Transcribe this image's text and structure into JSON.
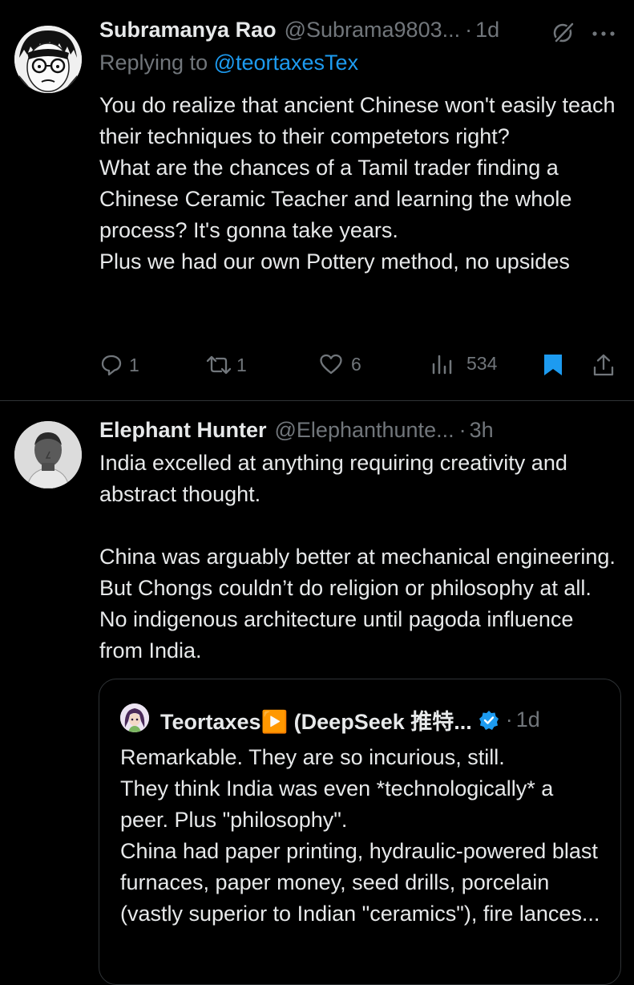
{
  "tweets": [
    {
      "author_name": "Subramanya Rao",
      "handle": "@Subrama9803...",
      "time": "1d",
      "replying_prefix": "Replying to ",
      "replying_to": "@teortaxesTex",
      "text": [
        "You do realize that ancient Chinese won't easily teach their techniques to their competetors right?",
        "What are the chances of a Tamil trader finding a Chinese Ceramic Teacher and learning the whole process? It's gonna take years.",
        "Plus we had our own Pottery method, no upsides"
      ],
      "actions": {
        "replies": "1",
        "reposts": "1",
        "likes": "6",
        "views": "534"
      }
    },
    {
      "author_name": "Elephant Hunter",
      "handle": "@Elephanthunte...",
      "time": "3h",
      "text": [
        "India excelled at anything requiring creativity and abstract thought.",
        "",
        "China was arguably better at mechanical engineering. But Chongs couldn’t do religion or philosophy at all. No indigenous architecture until pagoda influence from India."
      ],
      "quote": {
        "author_name": "Teortaxes▶️ (DeepSeek 推特...",
        "time": "1d",
        "text": [
          "Remarkable. They are so incurious, still.",
          "They think India was even *technologically* a peer. Plus \"philosophy\".",
          "China had paper printing, hydraulic-powered blast furnaces, paper money, seed drills, porcelain (vastly superior to Indian \"ceramics\"), fire lances..."
        ]
      }
    }
  ],
  "colors": {
    "background": "#000000",
    "text": "#e7e9ea",
    "muted": "#71767b",
    "link": "#1d9bf0",
    "divider": "#2f3336"
  }
}
